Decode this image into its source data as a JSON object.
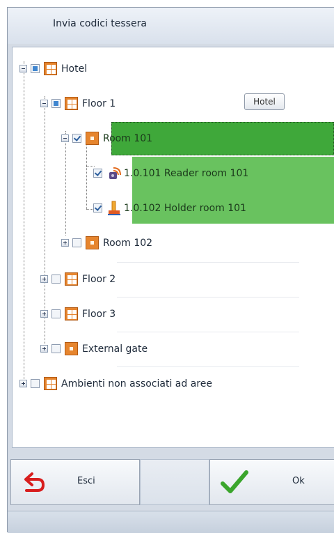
{
  "window": {
    "title": "Invia codici tessera"
  },
  "tooltip": "Hotel",
  "tree": {
    "hotel": "Hotel",
    "floor1": "Floor 1",
    "room101": "Room 101",
    "reader101": "1.0.101 Reader room 101",
    "holder101": "1.0.102 Holder room 101",
    "room102": "Room 102",
    "floor2": "Floor 2",
    "floor3": "Floor 3",
    "external_gate": "External gate",
    "unassigned": "Ambienti non associati ad aree"
  },
  "buttons": {
    "exit": "Esci",
    "ok": "Ok"
  },
  "colors": {
    "selected": "#3fa83a",
    "child_highlight": "#69c25f",
    "icon_orange": "#e6852e"
  },
  "icons": {
    "area": "grid-area-icon",
    "room": "room-icon",
    "reader": "card-reader-icon",
    "holder": "card-holder-icon",
    "exit": "undo-arrow-icon",
    "ok": "checkmark-icon"
  }
}
